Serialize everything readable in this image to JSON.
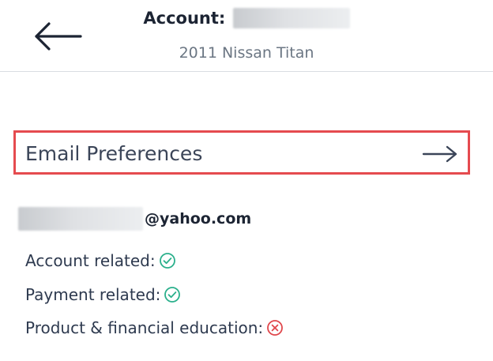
{
  "header": {
    "back_icon": "arrow-left-icon",
    "title_label": "Account:",
    "subtitle": "2011 Nissan Titan"
  },
  "email_preferences": {
    "label": "Email Preferences",
    "arrow_icon": "arrow-right-icon"
  },
  "email": {
    "domain_text": "@yahoo.com"
  },
  "categories": [
    {
      "label": "Account related:",
      "status": "enabled",
      "icon": "check-circle-icon"
    },
    {
      "label": "Payment related:",
      "status": "enabled",
      "icon": "check-circle-icon"
    },
    {
      "label": "Product & financial education:",
      "status": "disabled",
      "icon": "x-circle-icon"
    }
  ],
  "colors": {
    "enabled": "#2bb08c",
    "disabled": "#e0474c",
    "highlight_border": "#e54b4f",
    "text": "#2e3a4f"
  }
}
